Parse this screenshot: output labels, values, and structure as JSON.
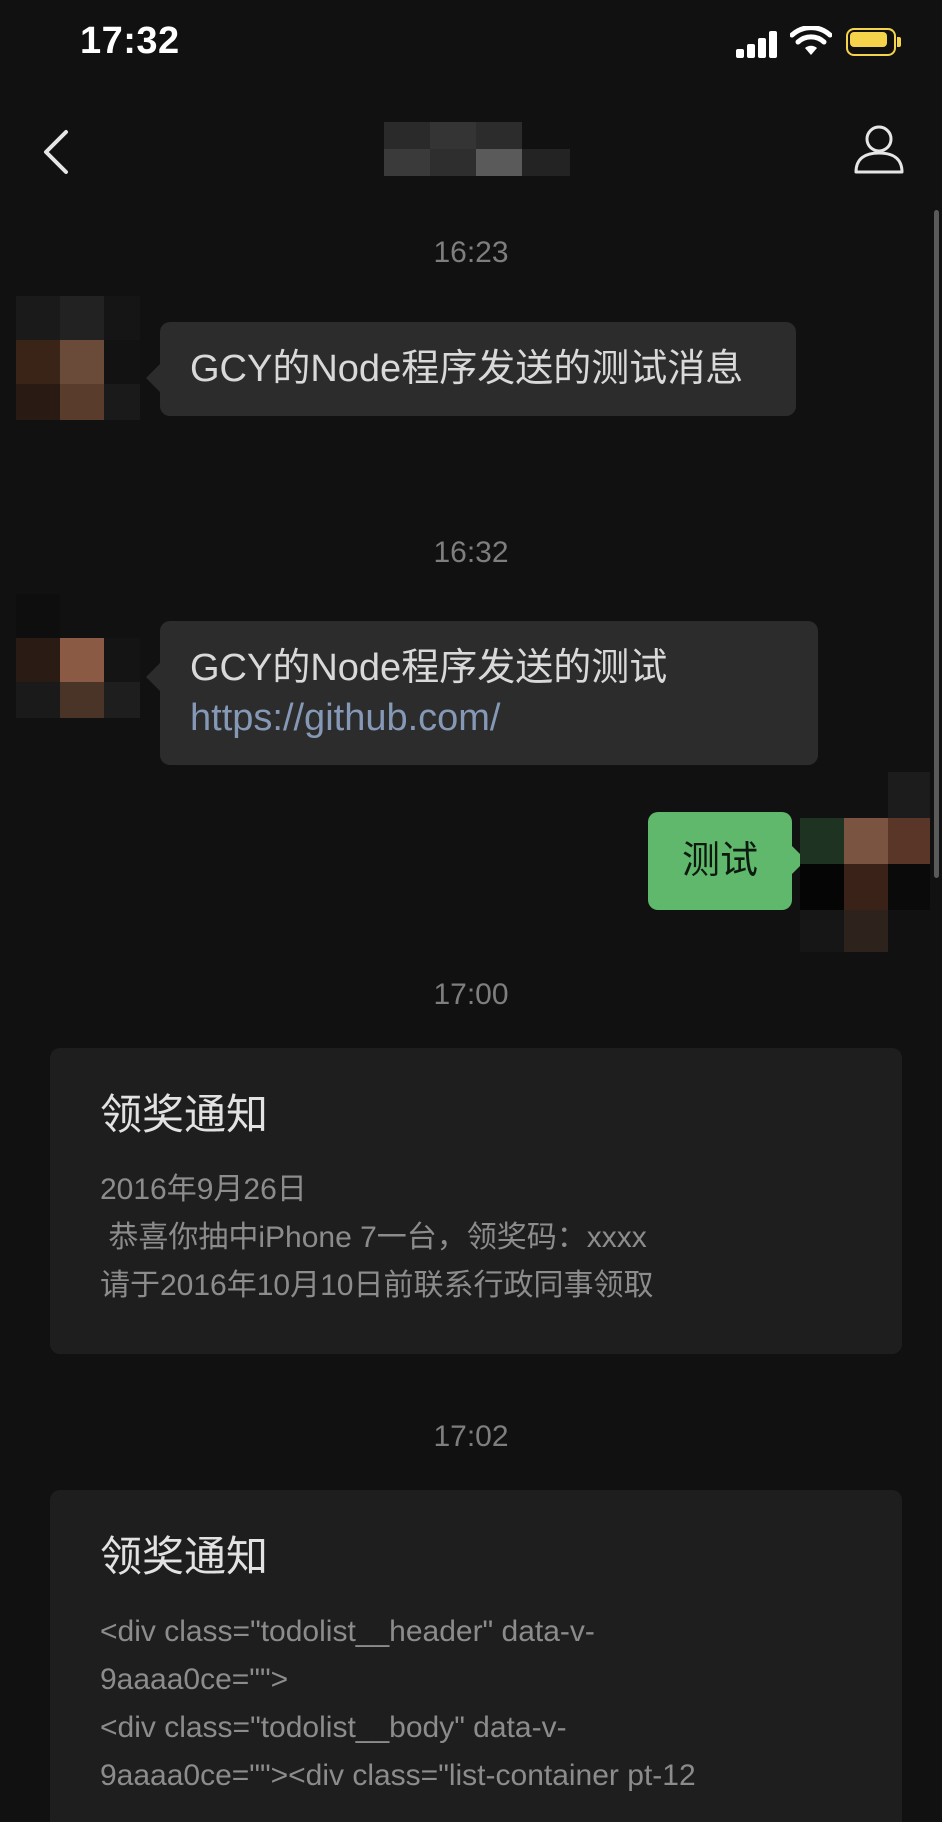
{
  "status_bar": {
    "time": "17:32"
  },
  "nav": {
    "back_icon": "chevron-left-icon",
    "profile_icon": "person-icon"
  },
  "messages": [
    {
      "type": "timestamp",
      "text": "16:23"
    },
    {
      "type": "incoming",
      "text": "GCY的Node程序发送的测试消息"
    },
    {
      "type": "timestamp",
      "text": "16:32"
    },
    {
      "type": "incoming",
      "text": "GCY的Node程序发送的测试 ",
      "link": "https://github.com/"
    },
    {
      "type": "outgoing",
      "text": "测试"
    },
    {
      "type": "timestamp",
      "text": "17:00"
    },
    {
      "type": "card",
      "title": "领奖通知",
      "lines": [
        "2016年9月26日",
        " 恭喜你抽中iPhone 7一台，领奖码：xxxx",
        "请于2016年10月10日前联系行政同事领取"
      ]
    },
    {
      "type": "timestamp",
      "text": "17:02"
    },
    {
      "type": "card",
      "title": "领奖通知",
      "lines": [
        "<div class=\"todolist__header\" data-v-",
        "9aaaa0ce=\"\">",
        "<div class=\"todolist__body\" data-v-",
        "9aaaa0ce=\"\"><div class=\"list-container pt-12"
      ]
    }
  ],
  "colors": {
    "background": "#111111",
    "incoming_bubble": "#2c2c2c",
    "outgoing_bubble": "#5fb86b",
    "link": "#8599b7",
    "battery": "#f5d34a",
    "card_bg": "#1e1e1e"
  }
}
